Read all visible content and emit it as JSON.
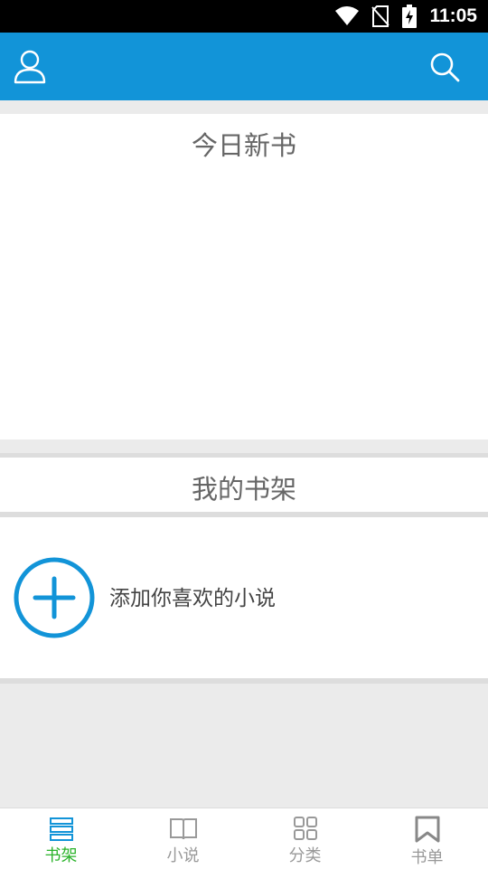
{
  "status_bar": {
    "time": "11:05"
  },
  "app_bar": {
    "profile_icon": "user-icon",
    "search_icon": "search-icon",
    "color": "#1294d8"
  },
  "today_new_books": {
    "title": "今日新书"
  },
  "my_bookshelf": {
    "title": "我的书架",
    "add_label": "添加你喜欢的小说"
  },
  "bottom_nav": {
    "items": [
      {
        "label": "书架",
        "icon": "bookshelf-icon",
        "active": true
      },
      {
        "label": "小说",
        "icon": "book-icon",
        "active": false
      },
      {
        "label": "分类",
        "icon": "grid-icon",
        "active": false
      },
      {
        "label": "书单",
        "icon": "bookmark-icon",
        "active": false
      }
    ],
    "active_color": "#2bb32b",
    "inactive_color": "#999999"
  }
}
